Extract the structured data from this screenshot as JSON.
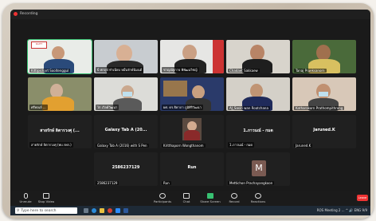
{
  "window": {
    "recording_label": "Recording"
  },
  "tiles": {
    "r1c1": "Kittipichart Sooltenggul",
    "r1c2": "6 ศกฤษ์ ทำเนียบ หมื่นรักษ์นิมนต์",
    "r1c3": "ชาญณัฐกาจ พิพัฒนวิชญ์",
    "r1c4": "Chadaet Sakkaew",
    "r1c5": "Tanaj Prueksanorn",
    "r2c1": "ศรีพลเล้ ...",
    "r2c2": "ไก่ เวิลด์วัฒนา",
    "r2c3": "ผศ. ดร.ธิดาภา ภูมิศิริวัฒนา",
    "r2c4": "AJ_Sasiri wan Roatchana",
    "r2c5": "Katharakorn Prathompithrong",
    "r3c1_name": "สายรักษ์ ลิตารวงศุ (...",
    "r3c1_label": "สายรักษ์ ลิตารวงศุ (พบ.รพร.)",
    "r3c2_name": "Galaxy Tab A (20...",
    "r3c2_label": "Galaxy Tab A (2016) with S Pen",
    "r3c3_label": "Kritthaporn Wongthanom",
    "r3c4_name": "1.ภาวนณ์ - กมด",
    "r3c4_label": "1.ภาวนณ์ - กมด",
    "r3c5_name": "Jaruned.K",
    "r3c5_label": "Jaruned.K",
    "r4c2_name": "2586237129",
    "r4c2_label": "2586237129",
    "r4c3_name": "Run",
    "r4c3_label": "Run",
    "r4c4_initial": "M",
    "r4c4_label": "Mettichon Prachayangkoon"
  },
  "toolbar": {
    "unmute": "Unmute",
    "stop_video": "Stop Video",
    "participants": "Participants",
    "participants_count": "23",
    "chat": "Chat",
    "share": "Share Screen",
    "record": "Record",
    "reactions": "Reactions",
    "leave": "Leave"
  },
  "taskbar": {
    "search_placeholder": "Type here to search",
    "tray_text": "ROS Meeting 2 ... ^ 🔊 ENG 9/9"
  }
}
